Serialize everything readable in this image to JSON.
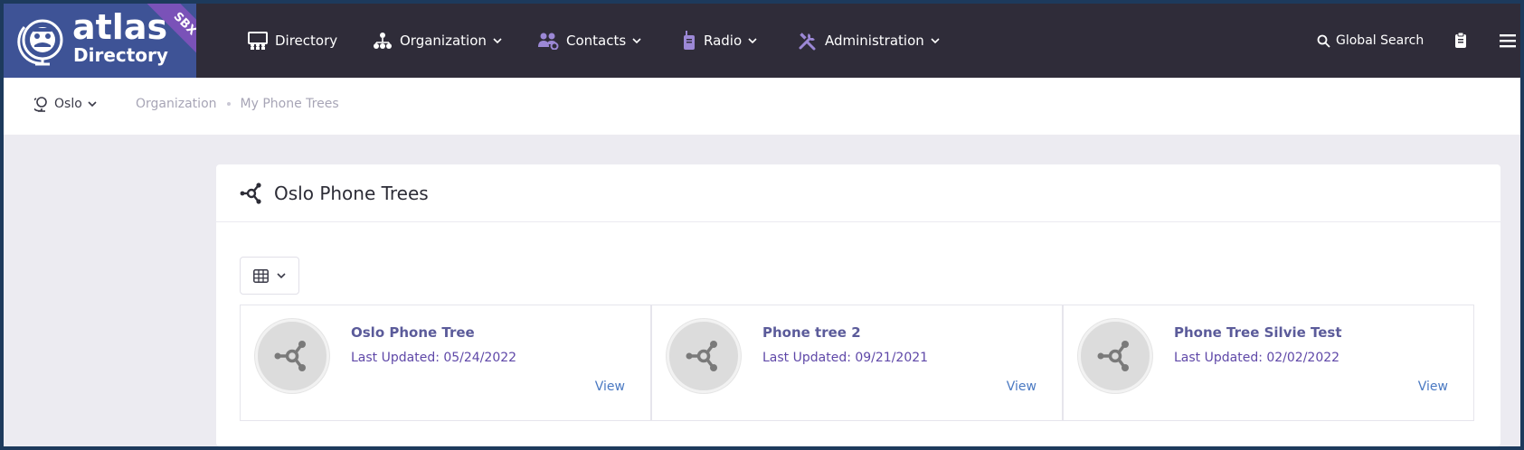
{
  "brand": {
    "name_top": "atlas",
    "name_bottom": "Directory",
    "env_badge": "SBX",
    "colors": {
      "logo_bg": "#3e5396",
      "badge": "#7a52b8",
      "nav_bg": "#2f2c39"
    }
  },
  "nav": {
    "items": [
      {
        "label": "Directory",
        "icon": "directory-icon",
        "has_dropdown": false
      },
      {
        "label": "Organization",
        "icon": "organization-icon",
        "has_dropdown": true
      },
      {
        "label": "Contacts",
        "icon": "contacts-icon",
        "has_dropdown": true
      },
      {
        "label": "Radio",
        "icon": "radio-icon",
        "has_dropdown": true
      },
      {
        "label": "Administration",
        "icon": "tools-icon",
        "has_dropdown": true
      }
    ],
    "search_label": "Global Search",
    "right_icons": [
      "clipboard-icon",
      "hamburger-menu-icon"
    ]
  },
  "subbar": {
    "location": "Oslo",
    "breadcrumb": [
      "Organization",
      "My Phone Trees"
    ]
  },
  "card": {
    "title": "Oslo Phone Trees",
    "view_mode_icon": "grid-icon",
    "trees": [
      {
        "name": "Oslo Phone Tree",
        "updated": "Last Updated: 05/24/2022",
        "action": "View"
      },
      {
        "name": "Phone tree 2",
        "updated": "Last Updated: 09/21/2021",
        "action": "View"
      },
      {
        "name": "Phone Tree Silvie Test",
        "updated": "Last Updated: 02/02/2022",
        "action": "View"
      }
    ]
  }
}
